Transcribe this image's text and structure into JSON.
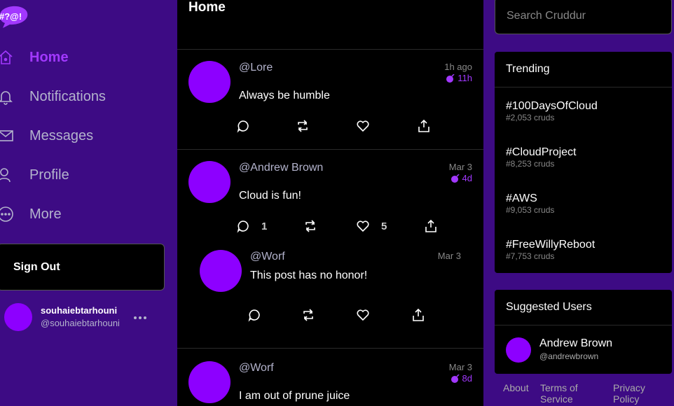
{
  "app": {
    "logo_text": "#?@!"
  },
  "nav": [
    {
      "label": "Home",
      "icon": "home-icon",
      "active": true
    },
    {
      "label": "Notifications",
      "icon": "bell-icon"
    },
    {
      "label": "Messages",
      "icon": "mail-icon"
    },
    {
      "label": "Profile",
      "icon": "profile-icon"
    },
    {
      "label": "More",
      "icon": "more-icon"
    }
  ],
  "signout_label": "Sign Out",
  "current_user": {
    "name": "souhaiebtarhouni",
    "handle": "@souhaiebtarhouni"
  },
  "feed": {
    "title": "Home",
    "posts": [
      {
        "handle": "@Lore",
        "body": "Always be humble",
        "time": "1h ago",
        "ttl": "11h",
        "replies": "",
        "likes": ""
      },
      {
        "handle": "@Andrew Brown",
        "body": "Cloud is fun!",
        "time": "Mar 3",
        "ttl": "4d",
        "replies": "1",
        "likes": "5"
      },
      {
        "handle": "@Worf",
        "body": "This post has no honor!",
        "time": "Mar 3",
        "ttl": "",
        "replies": "",
        "likes": ""
      },
      {
        "handle": "@Worf",
        "body": "I am out of prune juice",
        "time": "Mar 3",
        "ttl": "8d",
        "replies": "",
        "likes": ""
      }
    ]
  },
  "search": {
    "placeholder": "Search Cruddur"
  },
  "trending": {
    "title": "Trending",
    "items": [
      {
        "tag": "#100DaysOfCloud",
        "count": "#2,053 cruds"
      },
      {
        "tag": "#CloudProject",
        "count": "#8,253 cruds"
      },
      {
        "tag": "#AWS",
        "count": "#9,053 cruds"
      },
      {
        "tag": "#FreeWillyReboot",
        "count": "#7,753 cruds"
      }
    ]
  },
  "suggested": {
    "title": "Suggested Users",
    "users": [
      {
        "name": "Andrew Brown",
        "handle": "@andrewbrown"
      }
    ]
  },
  "footer": {
    "about": "About",
    "terms": "Terms of Service",
    "privacy": "Privacy Policy"
  },
  "colors": {
    "accent": "#a238ff",
    "avatar": "#8d00ff",
    "sidebar_bg": "#3d0b84"
  }
}
